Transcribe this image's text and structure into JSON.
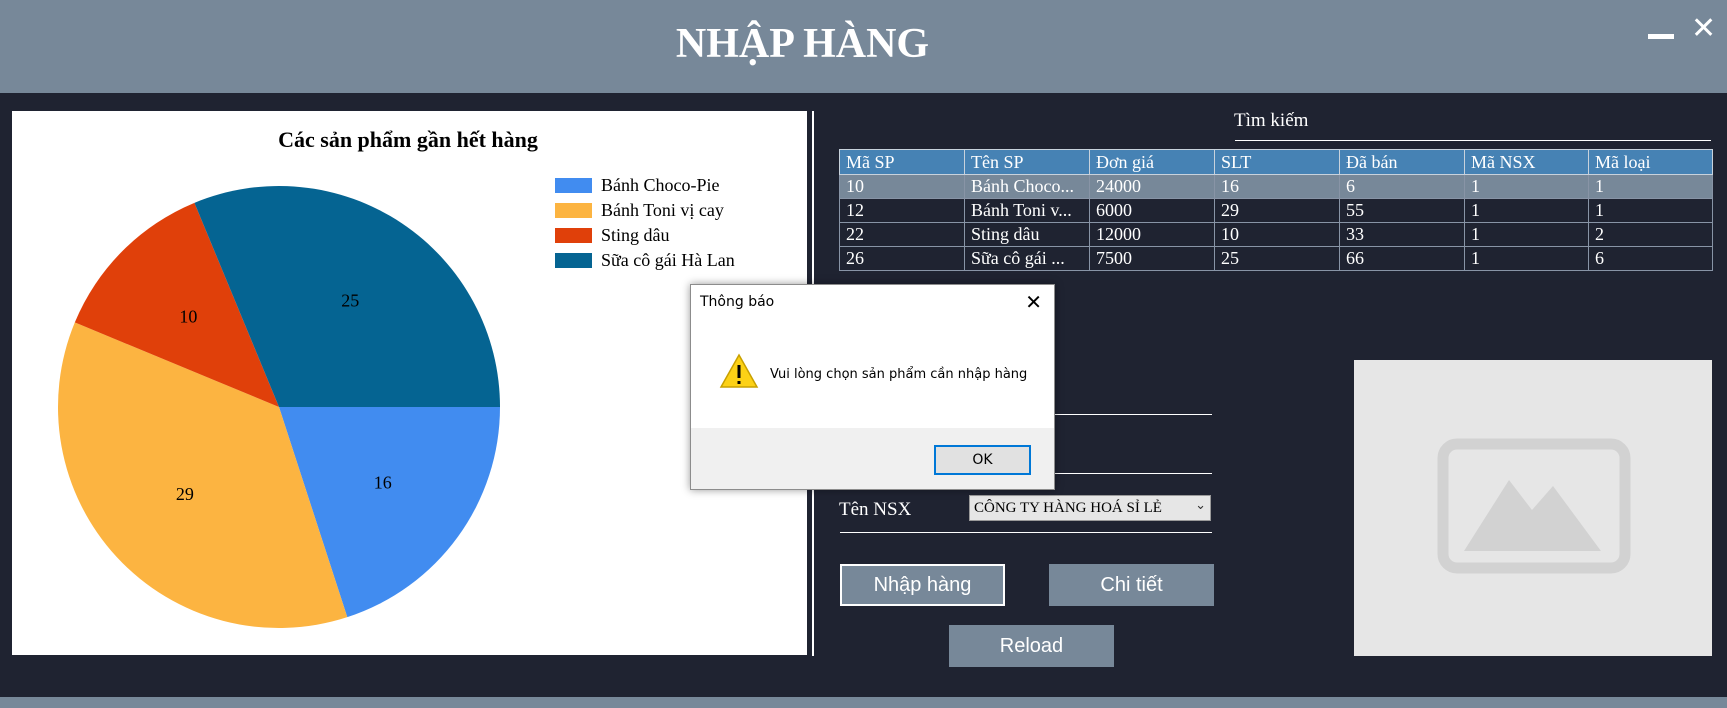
{
  "window": {
    "title": "NHẬP HÀNG",
    "minimize_icon": "minimize-icon",
    "close_icon": "close-icon"
  },
  "chart_data": {
    "type": "pie",
    "title": "Các sản phẩm gần hết hàng",
    "categories": [
      "Bánh Choco-Pie",
      "Bánh Toni vị cay",
      "Sting dâu",
      "Sữa cô gái Hà Lan"
    ],
    "values": [
      16,
      29,
      10,
      25
    ],
    "colors": [
      "#418cf0",
      "#fcb441",
      "#e0400a",
      "#056492"
    ],
    "legend_position": "top-right",
    "data_labels": true
  },
  "search": {
    "label": "Tìm kiếm"
  },
  "table": {
    "headers": [
      "Mã SP",
      "Tên SP",
      "Đơn giá",
      "SLT",
      "Đã bán",
      "Mã NSX",
      "Mã loại"
    ],
    "rows": [
      [
        "10",
        "Bánh Choco...",
        "24000",
        "16",
        "6",
        "1",
        "1"
      ],
      [
        "12",
        "Bánh Toni v...",
        "6000",
        "29",
        "55",
        "1",
        "1"
      ],
      [
        "22",
        "Sting dâu",
        "12000",
        "10",
        "33",
        "1",
        "2"
      ],
      [
        "26",
        "Sữa cô gái ...",
        "7500",
        "25",
        "66",
        "1",
        "6"
      ]
    ],
    "selected_row": 0
  },
  "form": {
    "nsx_label": "Tên NSX",
    "nsx_value": "CÔNG TY HÀNG HOÁ SỈ LẺ"
  },
  "buttons": {
    "nhap_hang": "Nhập hàng",
    "chi_tiet": "Chi tiết",
    "reload": "Reload"
  },
  "image_placeholder": {
    "icon": "image-placeholder-icon"
  },
  "dialog": {
    "title": "Thông báo",
    "message": "Vui lòng chọn sản phẩm cần nhập hàng",
    "ok_label": "OK",
    "icon": "warning-icon"
  }
}
